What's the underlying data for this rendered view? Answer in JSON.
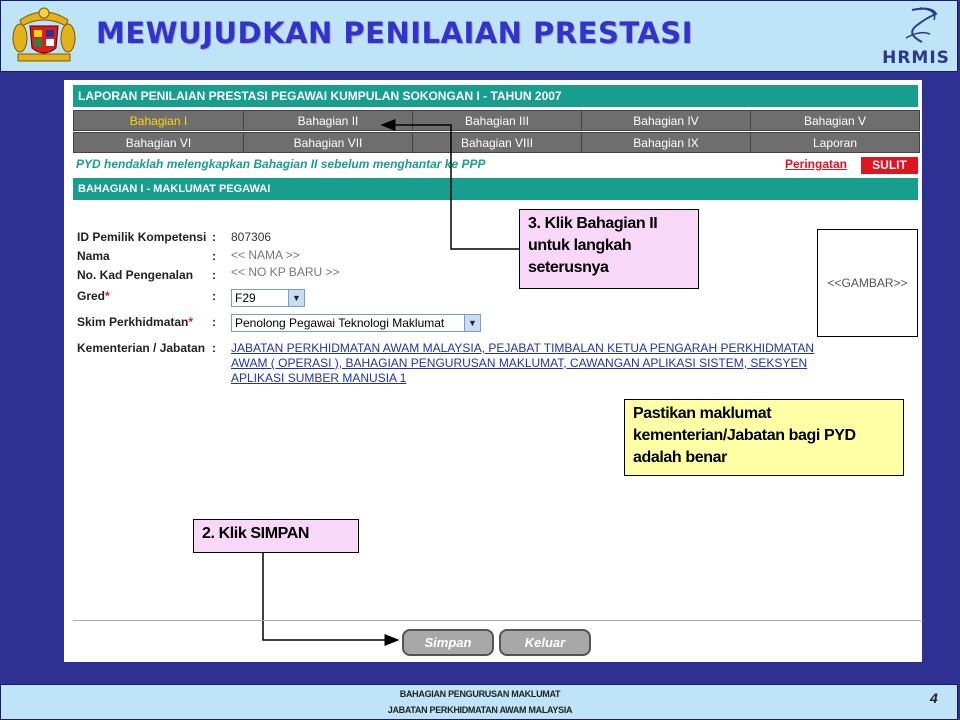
{
  "slide": {
    "title": "MEWUJUDKAN PENILAIAN PRESTASI",
    "logo_text": "HRMIS",
    "footer_line1": "BAHAGIAN PENGURUSAN MAKLUMAT",
    "footer_line2": "JABATAN PERKHIDMATAN AWAM MALAYSIA",
    "page_number": "4"
  },
  "app": {
    "header": "LAPORAN PENILAIAN PRESTASI PEGAWAI KUMPULAN SOKONGAN I - TAHUN 2007",
    "tabs": [
      {
        "label": "Bahagian I",
        "active": true
      },
      {
        "label": "Bahagian II"
      },
      {
        "label": "Bahagian III"
      },
      {
        "label": "Bahagian IV"
      },
      {
        "label": "Bahagian V"
      },
      {
        "label": "Bahagian VI"
      },
      {
        "label": "Bahagian VII"
      },
      {
        "label": "Bahagian VIII"
      },
      {
        "label": "Bahagian IX"
      },
      {
        "label": "Laporan"
      }
    ],
    "notice": "PYD hendaklah melengkapkan Bahagian II sebelum menghantar ke PPP",
    "notice_link": "Peringatan",
    "classification_badge": "SULIT",
    "section_header": "BAHAGIAN I - MAKLUMAT PEGAWAI",
    "fields": {
      "id_label": "ID Pemilik Kompetensi",
      "id_value": "807306",
      "name_label": "Nama",
      "name_value": "<< NAMA >>",
      "ic_label": "No. Kad Pengenalan",
      "ic_value": "<< NO KP BARU >>",
      "grade_label": "Gred",
      "grade_value": "F29",
      "scheme_label": "Skim Perkhidmatan",
      "scheme_value": "Penolong Pegawai Teknologi Maklumat",
      "ministry_label": "Kementerian / Jabatan",
      "ministry_value": "JABATAN PERKHIDMATAN AWAM MALAYSIA, PEJABAT TIMBALAN KETUA PENGARAH PERKHIDMATAN AWAM ( OPERASI ), BAHAGIAN PENGURUSAN MAKLUMAT, CAWANGAN APLIKASI SISTEM, SEKSYEN APLIKASI SUMBER MANUSIA 1",
      "colon": ":",
      "required_mark": "*"
    },
    "photo_placeholder": "<<GAMBAR>>",
    "buttons": {
      "save": "Simpan",
      "exit": "Keluar"
    }
  },
  "callouts": {
    "step3": "3. Klik Bahagian II untuk langkah seterusnya",
    "verify": "Pastikan maklumat kementerian/Jabatan bagi PYD adalah benar",
    "step2": "2. Klik SIMPAN"
  },
  "colors": {
    "background": "#2E3192",
    "teal_header": "#189E8F",
    "tab_grey": "#6E6E6E",
    "active_tab_text": "#FFD700",
    "alert_red": "#E0141E",
    "callout_pink": "#F8D7F8",
    "callout_yellow": "#FFFFA6"
  }
}
